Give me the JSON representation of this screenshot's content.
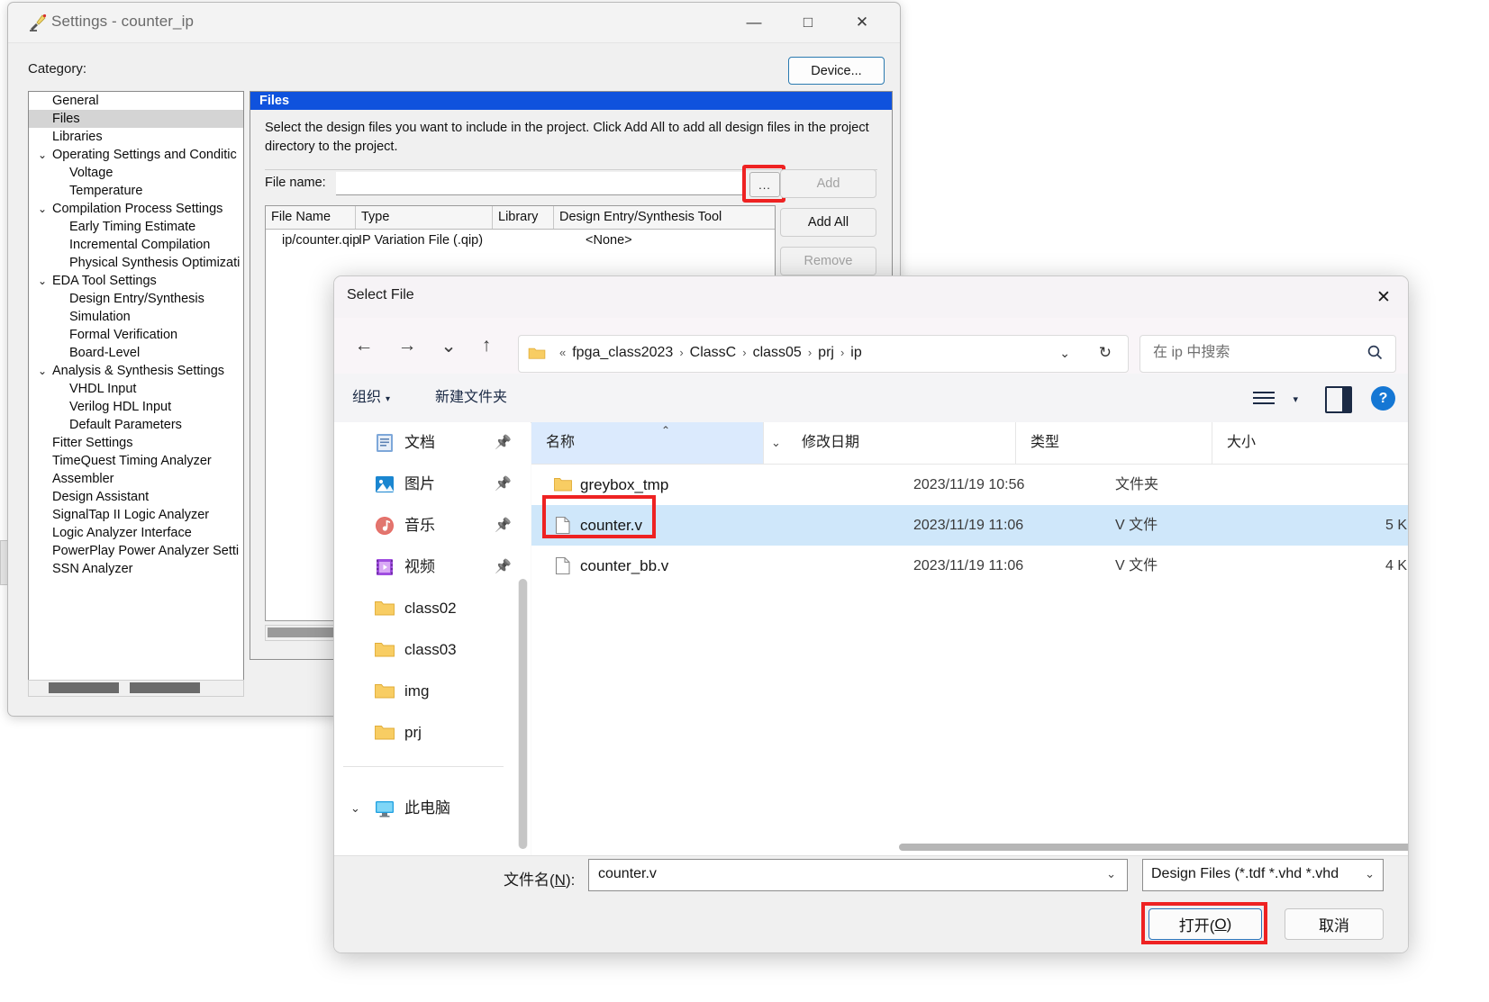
{
  "settings_window": {
    "title": "Settings - counter_ip",
    "icon": "quartus-settings-icon",
    "minimize": "—",
    "maximize": "□",
    "close": "✕",
    "category_label": "Category:",
    "device_button": "Device...",
    "category_tree": [
      {
        "label": "General",
        "level": 0,
        "chevron": "",
        "selected": false
      },
      {
        "label": "Files",
        "level": 0,
        "chevron": "",
        "selected": true
      },
      {
        "label": "Libraries",
        "level": 0,
        "chevron": "",
        "selected": false
      },
      {
        "label": "Operating Settings and Conditic",
        "level": 0,
        "chevron": "⌄",
        "selected": false
      },
      {
        "label": "Voltage",
        "level": 1,
        "chevron": "",
        "selected": false
      },
      {
        "label": "Temperature",
        "level": 1,
        "chevron": "",
        "selected": false
      },
      {
        "label": "Compilation Process Settings",
        "level": 0,
        "chevron": "⌄",
        "selected": false
      },
      {
        "label": "Early Timing Estimate",
        "level": 1,
        "chevron": "",
        "selected": false
      },
      {
        "label": "Incremental Compilation",
        "level": 1,
        "chevron": "",
        "selected": false
      },
      {
        "label": "Physical Synthesis Optimizati",
        "level": 1,
        "chevron": "",
        "selected": false
      },
      {
        "label": "EDA Tool Settings",
        "level": 0,
        "chevron": "⌄",
        "selected": false
      },
      {
        "label": "Design Entry/Synthesis",
        "level": 1,
        "chevron": "",
        "selected": false
      },
      {
        "label": "Simulation",
        "level": 1,
        "chevron": "",
        "selected": false
      },
      {
        "label": "Formal Verification",
        "level": 1,
        "chevron": "",
        "selected": false
      },
      {
        "label": "Board-Level",
        "level": 1,
        "chevron": "",
        "selected": false
      },
      {
        "label": "Analysis & Synthesis Settings",
        "level": 0,
        "chevron": "⌄",
        "selected": false
      },
      {
        "label": "VHDL Input",
        "level": 1,
        "chevron": "",
        "selected": false
      },
      {
        "label": "Verilog HDL Input",
        "level": 1,
        "chevron": "",
        "selected": false
      },
      {
        "label": "Default Parameters",
        "level": 1,
        "chevron": "",
        "selected": false
      },
      {
        "label": "Fitter Settings",
        "level": 0,
        "chevron": "",
        "selected": false
      },
      {
        "label": "TimeQuest Timing Analyzer",
        "level": 0,
        "chevron": "",
        "selected": false
      },
      {
        "label": "Assembler",
        "level": 0,
        "chevron": "",
        "selected": false
      },
      {
        "label": "Design Assistant",
        "level": 0,
        "chevron": "",
        "selected": false
      },
      {
        "label": "SignalTap II Logic Analyzer",
        "level": 0,
        "chevron": "",
        "selected": false
      },
      {
        "label": "Logic Analyzer Interface",
        "level": 0,
        "chevron": "",
        "selected": false
      },
      {
        "label": "PowerPlay Power Analyzer Setti",
        "level": 0,
        "chevron": "",
        "selected": false
      },
      {
        "label": "SSN Analyzer",
        "level": 0,
        "chevron": "",
        "selected": false
      }
    ],
    "files_panel": {
      "header": "Files",
      "description": "Select the design files you want to include in the project. Click Add All to add all design files in the project directory to the project.",
      "file_name_label": "File name:",
      "file_name_value": "",
      "browse_button": "...",
      "buttons": {
        "add": "Add",
        "add_all": "Add All",
        "remove": "Remove"
      },
      "table": {
        "columns": [
          "File Name",
          "Type",
          "Library",
          "Design Entry/Synthesis Tool"
        ],
        "rows": [
          {
            "file_name": "ip/counter.qip",
            "type": "IP Variation File (.qip)",
            "library": "",
            "tool": "<None>"
          }
        ]
      }
    }
  },
  "explorer": {
    "title": "Select File",
    "close_icon": "✕",
    "nav": {
      "back": "←",
      "forward": "→",
      "recent": "⌄",
      "up": "↑"
    },
    "breadcrumb": {
      "prefix": "«",
      "parts": [
        "fpga_class2023",
        "ClassC",
        "class05",
        "prj",
        "ip"
      ],
      "separator": "›",
      "dropdown_icon": "⌄",
      "refresh_icon": "↻"
    },
    "search": {
      "placeholder": "在 ip 中搜索",
      "icon": "search-icon"
    },
    "toolbar": {
      "organize": "组织",
      "organize_caret": "▾",
      "new_folder": "新建文件夹",
      "view_caret": "▾",
      "help": "?"
    },
    "nav_pane": [
      {
        "label": "文档",
        "icon": "documents-icon",
        "pinned": true
      },
      {
        "label": "图片",
        "icon": "pictures-icon",
        "pinned": true
      },
      {
        "label": "音乐",
        "icon": "music-icon",
        "pinned": true
      },
      {
        "label": "视频",
        "icon": "videos-icon",
        "pinned": true
      },
      {
        "label": "class02",
        "icon": "folder-icon",
        "pinned": false
      },
      {
        "label": "class03",
        "icon": "folder-icon",
        "pinned": false
      },
      {
        "label": "img",
        "icon": "folder-icon",
        "pinned": false
      },
      {
        "label": "prj",
        "icon": "folder-icon",
        "pinned": false
      }
    ],
    "this_pc": {
      "label": "此电脑",
      "icon": "monitor-icon",
      "chevron": "⌄"
    },
    "list": {
      "columns": [
        "名称",
        "修改日期",
        "类型",
        "大小"
      ],
      "sort_mark": "⌃",
      "column_chevron": "⌄",
      "rows": [
        {
          "name": "greybox_tmp",
          "icon": "folder-icon",
          "date": "2023/11/19 10:56",
          "type": "文件夹",
          "size": "",
          "selected": false,
          "highlighted": false
        },
        {
          "name": "counter.v",
          "icon": "file-icon",
          "date": "2023/11/19 11:06",
          "type": "V 文件",
          "size": "5 K",
          "selected": true,
          "highlighted": true
        },
        {
          "name": "counter_bb.v",
          "icon": "file-icon",
          "date": "2023/11/19 11:06",
          "type": "V 文件",
          "size": "4 K",
          "selected": false,
          "highlighted": false
        }
      ]
    },
    "footer": {
      "file_name_label": "文件名(N):",
      "file_name_label_plain": "文件名(",
      "file_name_label_accel": "N",
      "file_name_label_tail": "):",
      "file_name_value": "counter.v",
      "file_name_caret": "⌄",
      "filter_value": "Design Files (*.tdf *.vhd *.vhd",
      "filter_caret": "⌄",
      "open_button": "打开(O)",
      "open_button_plain": "打开(",
      "open_button_accel": "O",
      "open_button_tail": ")",
      "cancel_button": "取消"
    }
  },
  "colors": {
    "highlight_red": "#ee2222",
    "files_header_blue": "#0f52dd",
    "selection_blue": "#cfe7fa",
    "accent_blue": "#2e72b8"
  }
}
